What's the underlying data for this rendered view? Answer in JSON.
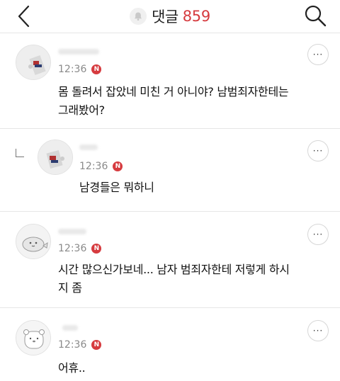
{
  "header": {
    "back_icon": "chevron-left-icon",
    "bell_icon": "bell-icon",
    "title": "댓글",
    "count": "859",
    "search_icon": "search-icon"
  },
  "colors": {
    "accent": "#d63b3f",
    "text": "#111111",
    "time": "#8a8a8a",
    "divider": "#e6e6e6"
  },
  "comments": [
    {
      "avatar": "avatar-photo",
      "time": "12:36",
      "badge": "N",
      "text_line1": "몸 돌려서 잡았네 미친 거 아니야? 남범죄자한테는",
      "text_line2": "그래봤어?",
      "more_label": "···",
      "reply": false
    },
    {
      "avatar": "avatar-photo",
      "time": "12:36",
      "badge": "N",
      "text_line1": "남경들은 뭐하니",
      "text_line2": "",
      "more_label": "···",
      "reply": true
    },
    {
      "avatar": "avatar-seal-character",
      "time": "12:36",
      "badge": "N",
      "text_line1": "시간 많으신가보네... 남자 범죄자한테 저렇게 하시",
      "text_line2": "지 좀",
      "more_label": "···",
      "reply": false
    },
    {
      "avatar": "avatar-bear-character",
      "time": "12:36",
      "badge": "N",
      "text_line1": "어휴..",
      "text_line2": "",
      "more_label": "···",
      "reply": false
    }
  ]
}
